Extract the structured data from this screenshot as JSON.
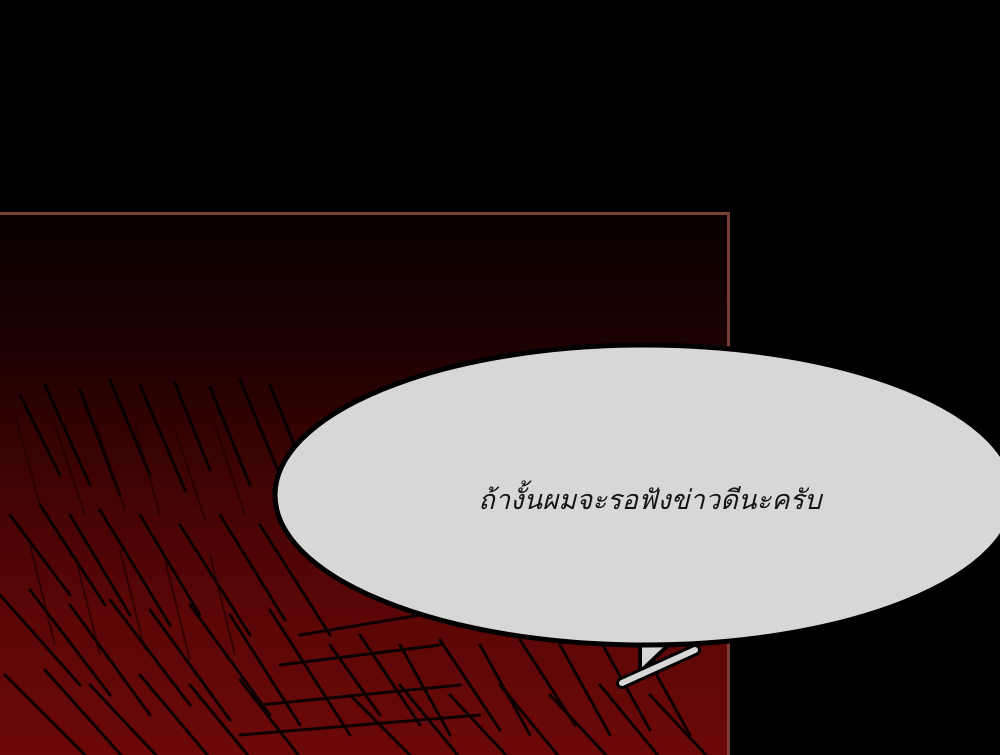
{
  "speech_bubble": {
    "text": "ถ้างั้นผมจะรอฟังข่าวดีนะครับ"
  },
  "colors": {
    "background": "#000000",
    "panel_border": "#7a3e36",
    "panel_fill": "#5a0606",
    "bubble_fill": "#d9d6d6",
    "text": "#141414"
  }
}
